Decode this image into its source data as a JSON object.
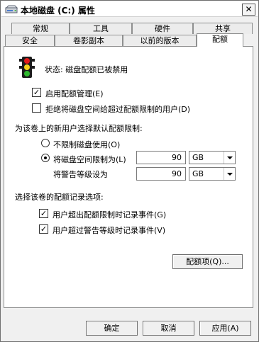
{
  "window": {
    "title": "本地磁盘 (C:) 属性",
    "close_glyph": "✕"
  },
  "tabs": {
    "row1": [
      "常规",
      "工具",
      "硬件",
      "共享"
    ],
    "row2": [
      "安全",
      "卷影副本",
      "以前的版本",
      "配额"
    ],
    "active": "配额"
  },
  "status": {
    "text": "状态:   磁盘配额已被禁用"
  },
  "options": {
    "enable_quota": {
      "label": "启用配额管理(E)",
      "checked": true
    },
    "deny_space": {
      "label": "拒绝将磁盘空间给超过配额限制的用户(D)",
      "checked": false
    }
  },
  "defaults": {
    "heading": "为该卷上的新用户选择默认配额限制:",
    "no_limit_label": "不限制磁盘使用(O)",
    "limit_label": "将磁盘空间限制为(L)",
    "limit_value": "90",
    "limit_unit": "GB",
    "warning_label": "将警告等级设为",
    "warning_value": "90",
    "warning_unit": "GB",
    "selected": "limit"
  },
  "logging": {
    "heading": "选择该卷的配额记录选项:",
    "log_limit_label": "用户超出配额限制时记录事件(G)",
    "log_limit_checked": true,
    "log_warning_label": "用户超过警告等级时记录事件(V)",
    "log_warning_checked": true
  },
  "buttons": {
    "quota_entries": "配额项(Q)...",
    "ok": "确定",
    "cancel": "取消",
    "apply": "应用(A)"
  },
  "colors": {
    "accent_red": "#e31b1b",
    "accent_yellow": "#f5d21a",
    "accent_green": "#2eb82e"
  }
}
